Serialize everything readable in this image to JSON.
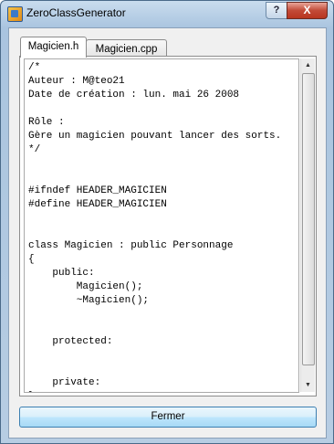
{
  "window": {
    "title": "ZeroClassGenerator"
  },
  "titlebar_buttons": {
    "help": "?",
    "close": "X"
  },
  "tabs": [
    {
      "label": "Magicien.h",
      "active": true
    },
    {
      "label": "Magicien.cpp",
      "active": false
    }
  ],
  "editor": {
    "content": "/*\nAuteur : M@teo21\nDate de création : lun. mai 26 2008\n\nRôle :\nGère un magicien pouvant lancer des sorts.\n*/\n\n\n#ifndef HEADER_MAGICIEN\n#define HEADER_MAGICIEN\n\n\nclass Magicien : public Personnage\n{\n    public:\n        Magicien();\n        ~Magicien();\n\n\n    protected:\n\n\n    private:\n};"
  },
  "scrollbar": {
    "up_glyph": "▲",
    "down_glyph": "▼"
  },
  "footer": {
    "close_label": "Fermer"
  },
  "colors": {
    "titlebar": "#b7cde3",
    "close_button": "#c24a37",
    "button_border": "#3c7fb1"
  },
  "icons": {
    "app": "generator-app-icon"
  }
}
